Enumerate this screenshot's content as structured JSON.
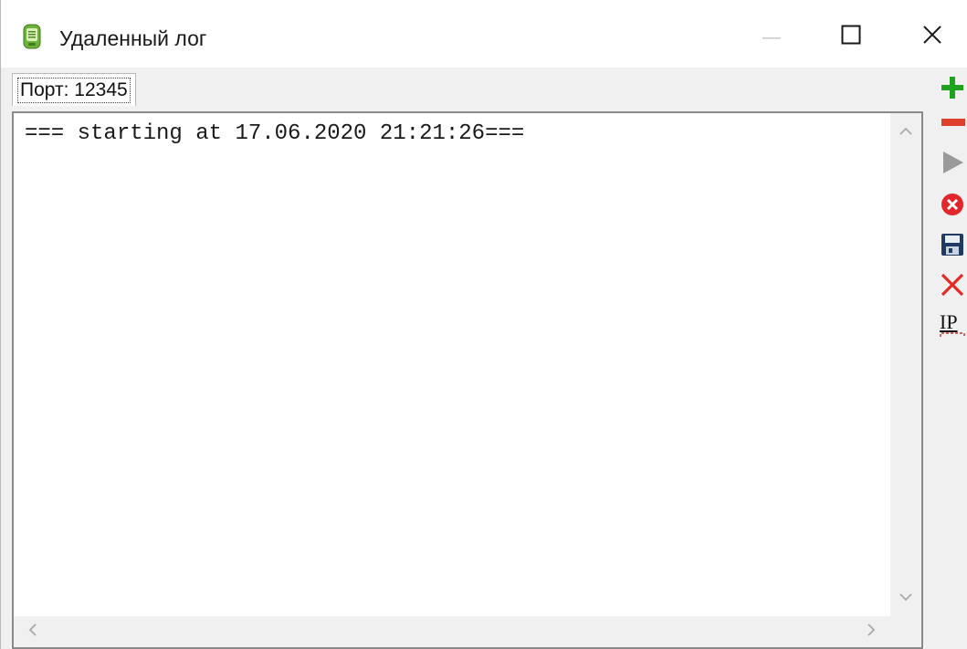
{
  "window": {
    "title": "Удаленный лог",
    "controls": {
      "minimize": "minimize-icon",
      "maximize": "maximize-icon",
      "close": "close-icon"
    }
  },
  "tabs": [
    {
      "label": "Порт: 12345",
      "selected": true
    }
  ],
  "log": {
    "lines": [
      "=== starting at 17.06.2020 21:21:26==="
    ]
  },
  "toolbar": {
    "items": [
      {
        "icon": "plus-icon",
        "color": "#1fa31f"
      },
      {
        "icon": "minus-icon",
        "color": "#e0402e"
      },
      {
        "icon": "play-icon",
        "color": "#9a9a9a"
      },
      {
        "icon": "stop-circle-icon",
        "color": "#e2262b"
      },
      {
        "icon": "save-icon",
        "color": "#1f3a63"
      },
      {
        "icon": "delete-x-icon",
        "color": "#e62a1f"
      },
      {
        "icon": "ip-settings-icon",
        "label": "IP"
      }
    ]
  }
}
